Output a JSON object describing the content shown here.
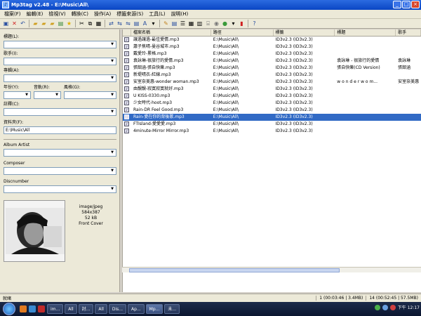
{
  "window": {
    "title": "Mp3tag v2.48  -  E:\\Music\\All\\"
  },
  "menu": [
    "檔案(F)",
    "編輯(E)",
    "檢視(V)",
    "轉換(C)",
    "操作(A)",
    "標籤來源(S)",
    "工具(L)",
    "說明(H)"
  ],
  "left_panel": {
    "title_label": "標題(L):",
    "artist_label": "歌手(I):",
    "album_label": "專輯(A):",
    "year_label": "年份(Y):",
    "track_label": "音軌(R):",
    "genre_label": "風格(G):",
    "comment_label": "註釋(C):",
    "folder_label": "資料夾(F):",
    "folder_value": "E:\\Music\\All",
    "album_artist_label": "Album Artist",
    "composer_label": "Composer",
    "discnumber_label": "Discnumber",
    "cover": {
      "mime": "image/jpeg",
      "dimensions": "584x387",
      "size": "52 kB",
      "type": "Front Cover"
    }
  },
  "file_list": {
    "columns": [
      "檔案名稱",
      "路徑",
      "標籤",
      "標題",
      "歌手"
    ],
    "rows": [
      {
        "file": "讓過讓過-最佳愛情.mp3",
        "path": "E:\\Music\\All\\",
        "tag": "ID3v2.3 (ID3v2.3)",
        "title": "",
        "artist": ""
      },
      {
        "file": "蕭子焦晴-曼谷城市.mp3",
        "path": "E:\\Music\\All\\",
        "tag": "ID3v2.3 (ID3v2.3)",
        "title": "",
        "artist": ""
      },
      {
        "file": "戴愛玲-累格.mp3",
        "path": "E:\\Music\\All\\",
        "tag": "ID3v2.3 (ID3v2.3)",
        "title": "",
        "artist": ""
      },
      {
        "file": "袁詠琳-很旅行的愛情.mp3",
        "path": "E:\\Music\\All\\",
        "tag": "ID3v2.3 (ID3v2.3)",
        "title": "袁詠琳 - 很旅行的愛情",
        "artist": "袁詠琳"
      },
      {
        "file": "張韶涵-張自快樂.mp3",
        "path": "E:\\Music\\All\\",
        "tag": "ID3v2.3 (ID3v2.3)",
        "title": "張自快樂(CD Version)",
        "artist": "張韶涵"
      },
      {
        "file": "新堤晴衣-紅線.mp3",
        "path": "E:\\Music\\All\\",
        "tag": "ID3v2.3 (ID3v2.3)",
        "title": "",
        "artist": ""
      },
      {
        "file": "安室奈美惠-wonder woman.mp3",
        "path": "E:\\Music\\All\\",
        "tag": "ID3v2.3 (ID3v2.3)",
        "title": "w o n d e r   w o m...",
        "artist": "安室奈美惠"
      },
      {
        "file": "由靚靚-寂寞寂寞就好.mp3",
        "path": "E:\\Music\\All\\",
        "tag": "ID3v2.3 (ID3v2.3)",
        "title": "",
        "artist": ""
      },
      {
        "file": "U KISS-0330.mp3",
        "path": "E:\\Music\\All\\",
        "tag": "ID3v2.3 (ID3v2.3)",
        "title": "",
        "artist": ""
      },
      {
        "file": "少女時代-hoot.mp3",
        "path": "E:\\Music\\All\\",
        "tag": "ID3v2.3 (ID3v2.3)",
        "title": "",
        "artist": ""
      },
      {
        "file": "Rain-DR Feel Good.mp3",
        "path": "E:\\Music\\All\\",
        "tag": "ID3v2.3 (ID3v2.3)",
        "title": "",
        "artist": ""
      },
      {
        "file": "Rain-愛在你的背後歌.mp3",
        "path": "E:\\Music\\All\\",
        "tag": "ID3v2.3 (ID3v2.3)",
        "title": "",
        "artist": "",
        "selected": true
      },
      {
        "file": "FTIsland-愛愛愛.mp3",
        "path": "E:\\Music\\All\\",
        "tag": "ID3v2.3 (ID3v2.3)",
        "title": "",
        "artist": ""
      },
      {
        "file": "4minute-Mirror Mirror.mp3",
        "path": "E:\\Music\\All\\",
        "tag": "ID3v2.3 (ID3v2.3)",
        "title": "",
        "artist": ""
      }
    ]
  },
  "status": {
    "left": "就緒",
    "selection": "1 (00:03:46 | 3.4MB)",
    "total": "14 (00:52:45 | 57.5MB)"
  },
  "taskbar": {
    "buttons": [
      "im...",
      "All",
      "討...",
      "All",
      "Dis...",
      "Ap...",
      "Mp...",
      "未..."
    ],
    "clock": "下午 12:17"
  },
  "colors": {
    "selection": "#316ac5",
    "titlebar": "#0a46c4"
  }
}
